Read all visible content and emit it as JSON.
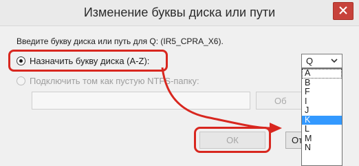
{
  "dialog": {
    "title": "Изменение буквы диска или пути",
    "prompt": "Введите букву диска или путь для Q: (IR5_CPRA_X6).",
    "option_assign_label": "Назначить букву диска (A-Z):",
    "option_mount_label": "Подключить том как пустую NTFS-папку:",
    "browse_label": "Об",
    "ok_label": "ОК",
    "cancel_label": "От"
  },
  "drive_combo": {
    "selected": "Q",
    "options": [
      "A",
      "B",
      "F",
      "I",
      "J",
      "K",
      "L",
      "M",
      "N"
    ],
    "highlighted": "K"
  },
  "colors": {
    "annotation_red": "#d8271f",
    "selection_blue": "#3399ff",
    "close_red": "#c7423b"
  }
}
